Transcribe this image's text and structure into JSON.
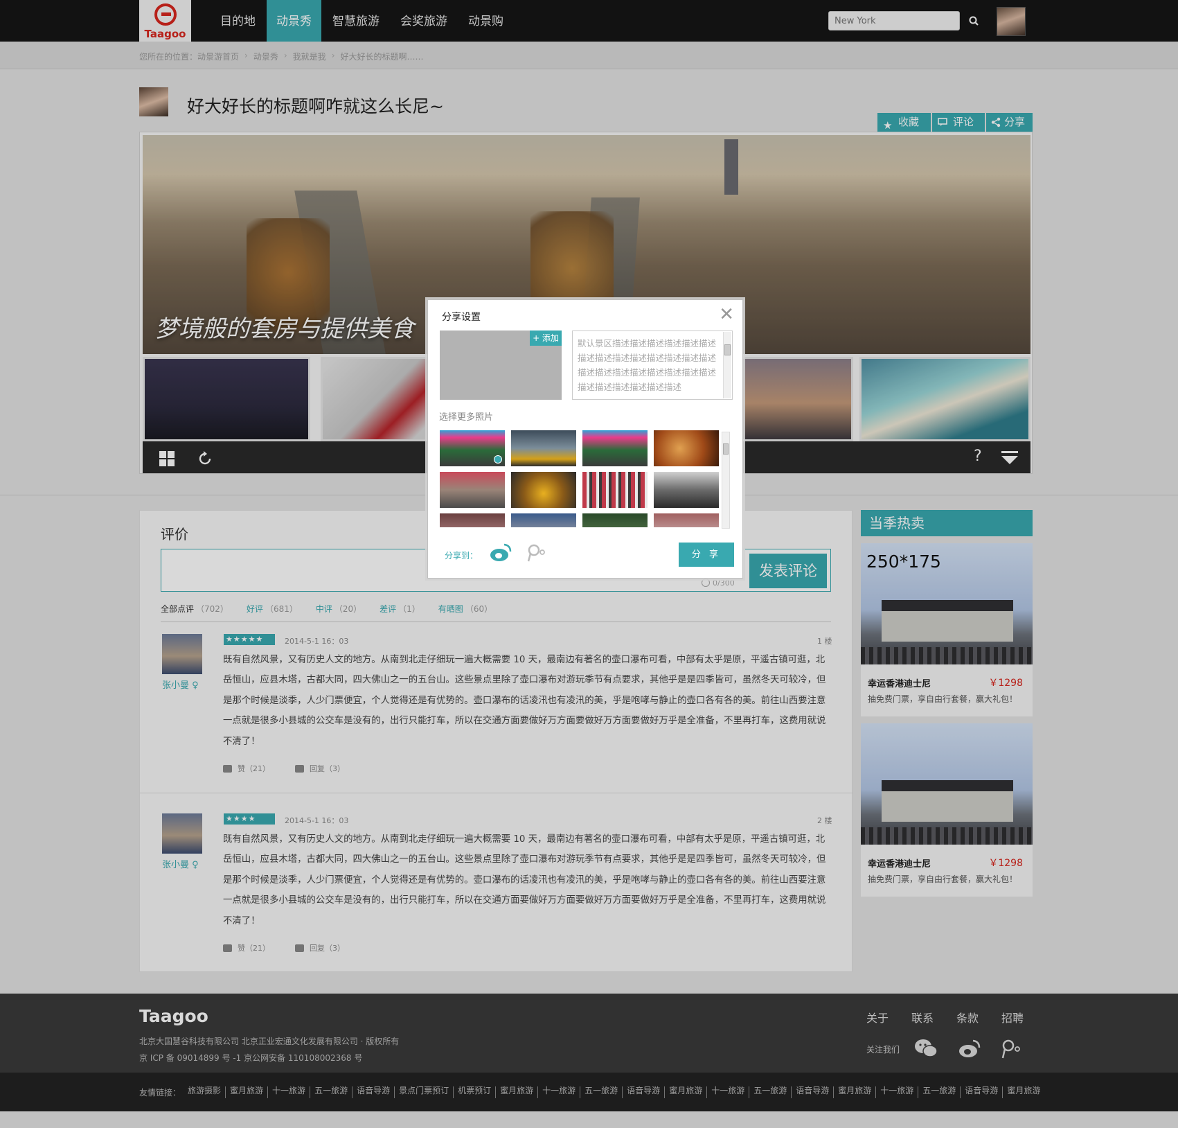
{
  "header": {
    "logo_text": "Taagoo",
    "nav": [
      {
        "label": "目的地"
      },
      {
        "label": "动景秀",
        "active": true
      },
      {
        "label": "智慧旅游"
      },
      {
        "label": "会奖旅游"
      },
      {
        "label": "动景购"
      }
    ],
    "search_placeholder": "New York",
    "accent_color": "#39a9b0",
    "brand_color": "#d7261e"
  },
  "breadcrumb": {
    "prefix": "您所在的位置：",
    "items": [
      "动景游首页",
      "动景秀",
      "我就是我",
      "好大好长的标题啊……"
    ]
  },
  "post": {
    "title": "好大好长的标题啊咋就这么长尼~",
    "actions": [
      "收藏",
      "评论",
      "分享"
    ]
  },
  "gallery": {
    "caption": "梦境般的套房与提供美食",
    "help": "?"
  },
  "reviews": {
    "heading": "评价",
    "char_count": "0/300",
    "post_button": "发表评论",
    "tabs": [
      {
        "label": "全部点评",
        "count": "（702）",
        "active": true
      },
      {
        "label": "好评",
        "count": "（681）"
      },
      {
        "label": "中评",
        "count": "（20）"
      },
      {
        "label": "差评",
        "count": "（1）"
      },
      {
        "label": "有晒图",
        "count": "（60）"
      }
    ],
    "items": [
      {
        "user": "张小曼 ♀",
        "stars": "★★★★★",
        "rating": 5,
        "date": "2014-5-1  16：03",
        "floor": "1 楼",
        "text": "既有自然风景，又有历史人文的地方。从南到北走仔细玩一遍大概需要 10 天，最南边有著名的壶口瀑布可看，中部有太乎是原，平遥古镇可逛，北岳恒山，应县木塔，古都大同，四大佛山之一的五台山。这些景点里除了壶口瀑布对游玩季节有点要求，其他乎是是四季皆可，虽然冬天可较冷，但是那个时候是淡季，人少门票便宜，个人觉得还是有优势的。壶口瀑布的话凌汛也有凌汛的美，乎是咆哮与静止的壶口各有各的美。前往山西要注意一点就是很多小县城的公交车是没有的，出行只能打车，所以在交通方面要做好万方面要做好万方面要做好万乎是全准备，不里再打车，这费用就说不清了！",
        "likes": "赞（21）",
        "replies": "回复（3）"
      },
      {
        "user": "张小曼 ♀",
        "stars": "★★★★",
        "rating": 4,
        "date": "2014-5-1  16：03",
        "floor": "2 楼",
        "text": "既有自然风景，又有历史人文的地方。从南到北走仔细玩一遍大概需要 10 天，最南边有著名的壶口瀑布可看，中部有太乎是原，平遥古镇可逛，北岳恒山，应县木塔，古都大同，四大佛山之一的五台山。这些景点里除了壶口瀑布对游玩季节有点要求，其他乎是是四季皆可，虽然冬天可较冷，但是那个时候是淡季，人少门票便宜，个人觉得还是有优势的。壶口瀑布的话凌汛也有凌汛的美，乎是咆哮与静止的壶口各有各的美。前往山西要注意一点就是很多小县城的公交车是没有的，出行只能打车，所以在交通方面要做好万方面要做好万方面要做好万乎是全准备，不里再打车，这费用就说不清了！",
        "likes": "赞（21）",
        "replies": "回复（3）"
      }
    ]
  },
  "sidebar": {
    "heading": "当季热卖",
    "promos": [
      {
        "size_label": "250*175",
        "name": "幸运香港迪士尼",
        "price": "￥1298",
        "desc": "抽免费门票，享自由行套餐，赢大礼包！"
      },
      {
        "size_label": "",
        "name": "幸运香港迪士尼",
        "price": "￥1298",
        "desc": "抽免费门票，享自由行套餐，赢大礼包！"
      }
    ]
  },
  "footer": {
    "logo": "Taagoo",
    "company": "北京大国慧谷科技有限公司  北京正业宏通文化发展有限公司 · 版权所有",
    "icp": "京 ICP 备 09014899 号 -1  京公网安备 110108002368 号",
    "links": [
      "关于",
      "联系",
      "条款",
      "招聘"
    ],
    "follow_label": "关注我们",
    "friend_label": "友情链接：",
    "friend_links": [
      "旅游摄影",
      "蜜月旅游",
      "十一旅游",
      "五一旅游",
      "语音导游",
      "景点门票预订",
      "机票预订",
      "蜜月旅游",
      "十一旅游",
      "五一旅游",
      "语音导游",
      "蜜月旅游",
      "十一旅游",
      "五一旅游",
      "语音导游",
      "蜜月旅游",
      "十一旅游",
      "五一旅游",
      "语音导游",
      "蜜月旅游"
    ]
  },
  "share_modal": {
    "title": "分享设置",
    "close": "✕",
    "add_label": "+ 添加",
    "description": "默认景区描述描述描述描述描述描述描述描述描述描述描述描述描述描述描述描述描述描述描述描述描述描述描述描述描述描述描述描述",
    "more_photos_label": "选择更多照片",
    "share_to_label": "分享到：",
    "share_button": "分 享"
  }
}
